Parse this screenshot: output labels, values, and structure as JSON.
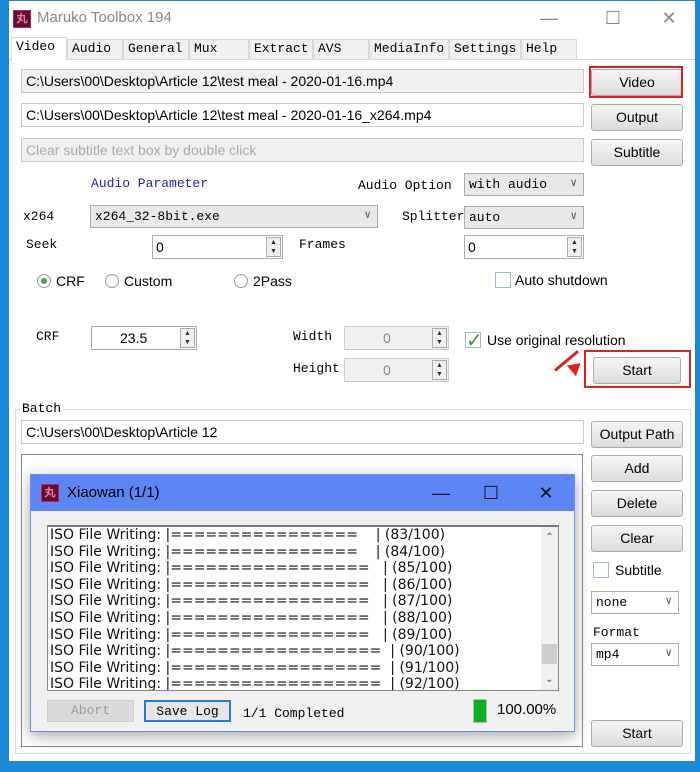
{
  "window": {
    "title": "Maruko Toolbox 194",
    "icon_glyph": "丸",
    "controls": {
      "minimize": "—",
      "maximize": "☐",
      "close": "✕"
    }
  },
  "tabs": [
    {
      "label": "Video",
      "active": true
    },
    {
      "label": "Audio"
    },
    {
      "label": "General"
    },
    {
      "label": "Mux"
    },
    {
      "label": "Extract"
    },
    {
      "label": "AVS"
    },
    {
      "label": "MediaInfo"
    },
    {
      "label": "Settings"
    },
    {
      "label": "Help"
    }
  ],
  "video": {
    "input_path": "C:\\Users\\00\\Desktop\\Article 12\\test meal - 2020-01-16.mp4",
    "output_path": "C:\\Users\\00\\Desktop\\Article 12\\test meal - 2020-01-16_x264.mp4",
    "subtitle_placeholder": "Clear subtitle text box by double click",
    "video_button": "Video",
    "output_button": "Output",
    "subtitle_button": "Subtitle",
    "audio_parameter_link": "Audio Parameter",
    "audio_option_label": "Audio Option",
    "audio_option_value": "with audio",
    "encoder_label": "x264",
    "encoder_value": "x264_32-8bit.exe",
    "splitter_label": "Splitter",
    "splitter_value": "auto",
    "seek_label": "Seek",
    "seek_value": "0",
    "frames_label": "Frames",
    "frames_value": "0",
    "mode_options": [
      {
        "label": "CRF",
        "selected": true
      },
      {
        "label": "Custom",
        "selected": false
      },
      {
        "label": "2Pass",
        "selected": false
      }
    ],
    "auto_shutdown_label": "Auto shutdown",
    "auto_shutdown_checked": false,
    "crf_label": "CRF",
    "crf_value": "23.5",
    "width_label": "Width",
    "width_value": "0",
    "height_label": "Height",
    "height_value": "0",
    "use_original_resolution_label": "Use original resolution",
    "use_original_resolution_checked": true,
    "start_button": "Start"
  },
  "batch": {
    "group_label": "Batch",
    "output_path": "C:\\Users\\00\\Desktop\\Article 12",
    "output_path_button": "Output Path",
    "add_button": "Add",
    "delete_button": "Delete",
    "clear_button": "Clear",
    "subtitle_checkbox_label": "Subtitle",
    "subtitle_checked": false,
    "subtitle_mode_value": "none",
    "format_label": "Format",
    "format_value": "mp4",
    "start_button": "Start"
  },
  "progress_dialog": {
    "title": "Xiaowan (1/1)",
    "icon_glyph": "丸",
    "controls": {
      "minimize": "—",
      "maximize": "☐",
      "close": "✕"
    },
    "log_lines": [
      "ISO File Writing: |================    | (83/100)",
      "ISO File Writing: |================    | (84/100)",
      "ISO File Writing: |=================   | (85/100)",
      "ISO File Writing: |=================   | (86/100)",
      "ISO File Writing: |=================   | (87/100)",
      "ISO File Writing: |=================   | (88/100)",
      "ISO File Writing: |=================   | (89/100)",
      "ISO File Writing: |==================  | (90/100)",
      "ISO File Writing: |==================  | (91/100)",
      "ISO File Writing: |==================  | (92/100)"
    ],
    "abort_button": "Abort",
    "save_log_button": "Save Log",
    "status_text": "1/1 Completed",
    "progress_percent_text": "100.00%",
    "progress_fraction": 1.0,
    "progress_color": "#06b025"
  },
  "colors": {
    "highlight_red": "#e02020",
    "dialog_titlebar": "#5b86f4",
    "link_blue": "#1a1ae0"
  }
}
